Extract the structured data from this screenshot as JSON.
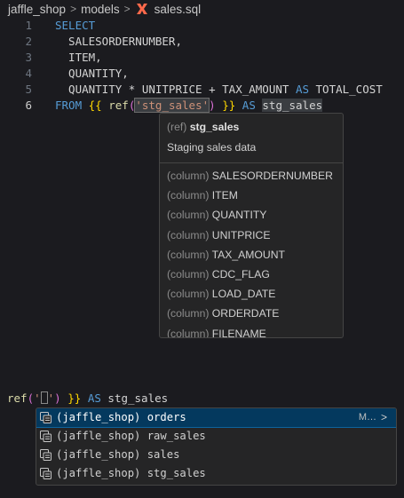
{
  "breadcrumb": {
    "project": "jaffle_shop",
    "folder": "models",
    "file": "sales.sql",
    "file_icon": "dbt-logo-icon",
    "separator": ">"
  },
  "editor": {
    "lines": [
      {
        "n": "1",
        "parts": [
          {
            "t": "SELECT",
            "c": "kw"
          }
        ]
      },
      {
        "n": "2",
        "parts": [
          {
            "t": "  SALESORDERNUMBER,",
            "c": "ident"
          }
        ]
      },
      {
        "n": "3",
        "parts": [
          {
            "t": "  ITEM,",
            "c": "ident"
          }
        ]
      },
      {
        "n": "4",
        "parts": [
          {
            "t": "  QUANTITY,",
            "c": "ident"
          }
        ]
      },
      {
        "n": "5",
        "parts": [
          {
            "t": "  QUANTITY * UNITPRICE + TAX_AMOUNT ",
            "c": "ident"
          },
          {
            "t": "AS",
            "c": "kw"
          },
          {
            "t": " TOTAL_COST",
            "c": "ident"
          }
        ]
      },
      {
        "n": "6",
        "active": true,
        "parts": [
          {
            "t": "FROM",
            "c": "kw"
          },
          {
            "t": " ",
            "c": "ident"
          },
          {
            "t": "{{",
            "c": "brace"
          },
          {
            "t": " ",
            "c": "ident"
          },
          {
            "t": "ref",
            "c": "fn"
          },
          {
            "t": "(",
            "c": "paren"
          },
          {
            "t": "'stg_sales'",
            "c": "str",
            "box": true
          },
          {
            "t": ")",
            "c": "paren"
          },
          {
            "t": " ",
            "c": "ident"
          },
          {
            "t": "}}",
            "c": "brace"
          },
          {
            "t": " ",
            "c": "ident"
          },
          {
            "t": "AS",
            "c": "kw"
          },
          {
            "t": " ",
            "c": "ident"
          },
          {
            "t": "stg_sales",
            "c": "ident",
            "hl": true
          }
        ]
      }
    ]
  },
  "hover": {
    "kind": "(ref)",
    "name": "stg_sales",
    "description": "Staging sales data",
    "column_kind": "(column)",
    "columns": [
      "SALESORDERNUMBER",
      "ITEM",
      "QUANTITY",
      "UNITPRICE",
      "TAX_AMOUNT",
      "CDC_FLAG",
      "LOAD_DATE",
      "ORDERDATE",
      "FILENAME"
    ]
  },
  "snippet": {
    "parts": [
      {
        "t": "ref",
        "c": "fn"
      },
      {
        "t": "(",
        "c": "paren"
      },
      {
        "t": "'",
        "c": "str"
      },
      {
        "cursor": true
      },
      {
        "t": "'",
        "c": "str"
      },
      {
        "t": ")",
        "c": "paren"
      },
      {
        "t": " ",
        "c": "ident"
      },
      {
        "t": "}}",
        "c": "brace"
      },
      {
        "t": " ",
        "c": "ident"
      },
      {
        "t": "AS",
        "c": "kw"
      },
      {
        "t": " stg_sales",
        "c": "ident"
      }
    ]
  },
  "suggestions": {
    "icon": "model-file-icon",
    "items": [
      {
        "label": "(jaffle_shop) orders",
        "selected": true,
        "detail": "M…",
        "chevron": ">"
      },
      {
        "label": "(jaffle_shop) raw_sales"
      },
      {
        "label": "(jaffle_shop) sales"
      },
      {
        "label": "(jaffle_shop) stg_sales"
      }
    ]
  },
  "colors": {
    "background": "#1b1b1f",
    "keyword": "#569cd6",
    "string": "#ce9178",
    "function": "#dcdcaa",
    "brace": "#ffd700",
    "paren": "#da70d6",
    "selection": "#04395e"
  }
}
